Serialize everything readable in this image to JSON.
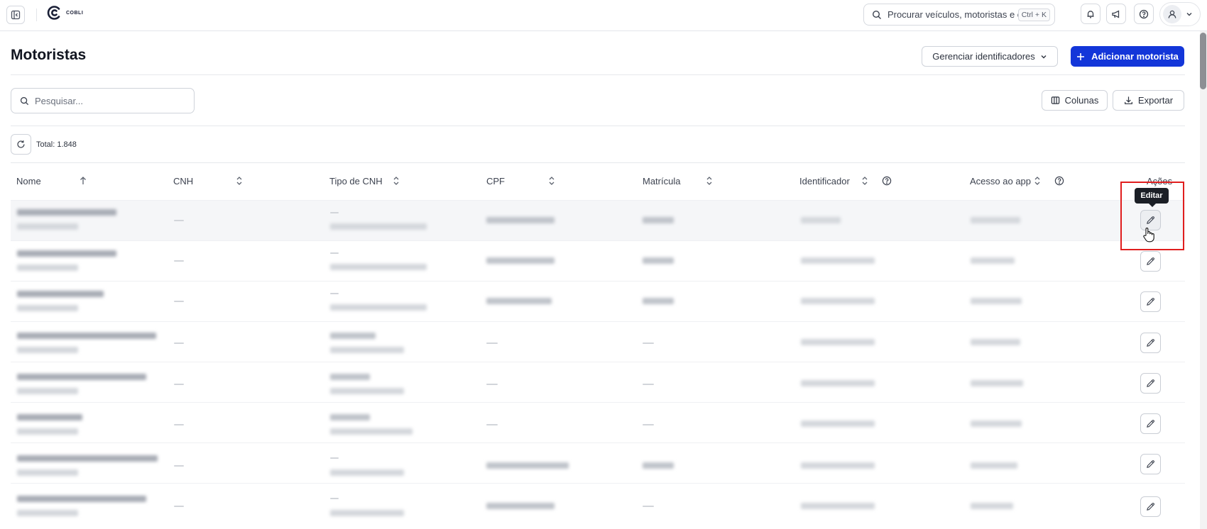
{
  "topbar": {
    "logo_text": "COBLI",
    "search_placeholder": "Procurar veículos, motoristas e etc...",
    "search_shortcut": "Ctrl + K",
    "icons": [
      "sidebar-toggle-icon",
      "bell-icon",
      "megaphone-icon",
      "help-icon",
      "user-icon",
      "chevron-down-icon"
    ]
  },
  "header": {
    "title": "Motoristas",
    "manage_identifiers_label": "Gerenciar identificadores",
    "add_driver_label": "Adicionar motorista"
  },
  "toolbar": {
    "search_placeholder": "Pesquisar...",
    "columns_label": "Colunas",
    "export_label": "Exportar",
    "total_label": "Total: 1.848"
  },
  "table": {
    "columns": [
      "Nome",
      "CNH",
      "Tipo de CNH",
      "CPF",
      "Matrícula",
      "Identificador",
      "Acesso ao app",
      "Ações"
    ],
    "sorted_column": "Nome",
    "sort_direction": "asc",
    "row_count_visible": 8,
    "hovered_row": 1
  },
  "tooltip": {
    "edit_label": "Editar"
  },
  "colors": {
    "primary": "#1336d9",
    "highlight": "#e01e1e",
    "tooltip_bg": "#1b1f26"
  }
}
